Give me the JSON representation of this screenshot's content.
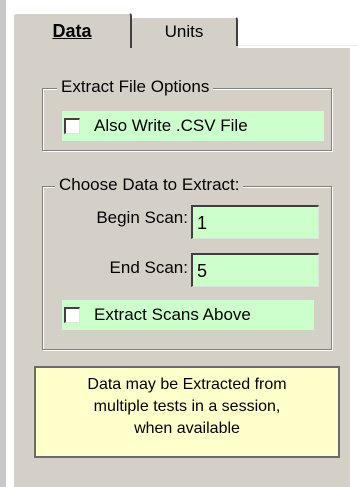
{
  "tabs": [
    {
      "label": "Data",
      "selected": true
    },
    {
      "label": "Units",
      "selected": false
    }
  ],
  "extract_options": {
    "title": "Extract File Options",
    "also_write_csv": {
      "label": "Also Write .CSV File",
      "checked": false
    }
  },
  "choose_data": {
    "title": "Choose Data to Extract:",
    "begin_scan": {
      "label": "Begin Scan:",
      "value": "1"
    },
    "end_scan": {
      "label": "End Scan:",
      "value": "5"
    },
    "extract_scans_above": {
      "label": "Extract Scans Above",
      "checked": false
    }
  },
  "note": {
    "line1": "Data may be Extracted from",
    "line2": "multiple tests in a session,",
    "line3": "when available"
  },
  "colors": {
    "panel": "#d4d0c8",
    "field_green": "#ccffcc",
    "note_yellow": "#ffffcc"
  }
}
